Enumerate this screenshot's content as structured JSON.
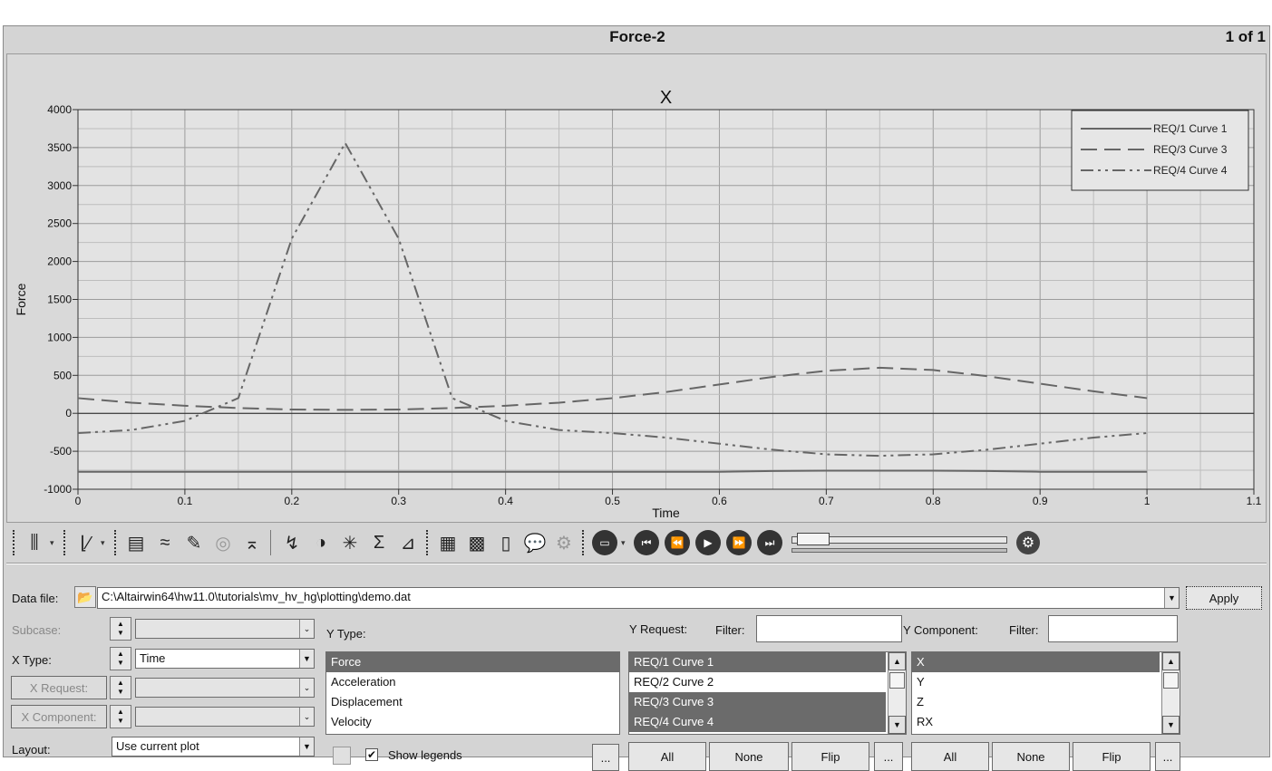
{
  "window": {
    "title": "Force-2",
    "page_count": "1 of 1"
  },
  "chart_data": {
    "type": "line",
    "title": "X",
    "xlabel": "Time",
    "ylabel": "Force",
    "xlim": [
      0,
      1.1
    ],
    "ylim": [
      -1000,
      4000
    ],
    "x_ticks": [
      "0",
      "0.1",
      "0.2",
      "0.3",
      "0.4",
      "0.5",
      "0.6",
      "0.7",
      "0.8",
      "0.9",
      "1",
      "1.1"
    ],
    "y_ticks": [
      "4000",
      "3500",
      "3000",
      "2500",
      "2000",
      "1500",
      "1000",
      "500",
      "0",
      "-500",
      "-1000"
    ],
    "grid": true,
    "legend": "top-right",
    "series": [
      {
        "name": "REQ/1 Curve 1",
        "style": "solid",
        "x": [
          0,
          0.1,
          0.2,
          0.3,
          0.4,
          0.5,
          0.6,
          0.65,
          0.7,
          0.8,
          0.85,
          0.9,
          1.0
        ],
        "y": [
          -770,
          -770,
          -770,
          -770,
          -770,
          -770,
          -770,
          -760,
          -755,
          -755,
          -760,
          -770,
          -770
        ]
      },
      {
        "name": "REQ/3 Curve 3",
        "style": "dash",
        "x": [
          0,
          0.05,
          0.1,
          0.15,
          0.2,
          0.25,
          0.3,
          0.35,
          0.4,
          0.45,
          0.5,
          0.55,
          0.6,
          0.65,
          0.7,
          0.75,
          0.8,
          0.85,
          0.9,
          0.95,
          1.0
        ],
        "y": [
          200,
          140,
          100,
          70,
          50,
          45,
          50,
          70,
          100,
          140,
          200,
          280,
          380,
          480,
          560,
          600,
          570,
          490,
          390,
          290,
          200
        ]
      },
      {
        "name": "REQ/4 Curve 4",
        "style": "dashdotdot",
        "x": [
          0,
          0.05,
          0.1,
          0.15,
          0.2,
          0.25,
          0.3,
          0.35,
          0.4,
          0.45,
          0.5,
          0.55,
          0.6,
          0.65,
          0.7,
          0.75,
          0.8,
          0.85,
          0.9,
          0.95,
          1.0
        ],
        "y": [
          -260,
          -220,
          -100,
          200,
          2300,
          3560,
          2300,
          200,
          -100,
          -220,
          -260,
          -320,
          -400,
          -480,
          -540,
          -560,
          -540,
          -480,
          -400,
          -320,
          -260
        ]
      }
    ]
  },
  "toolbar": {
    "icons": [
      "plot-type-icon",
      "curve-type-icon",
      "curve-attributes-icon",
      "define-curve-icon",
      "edit-curve-icon",
      "stamp-icon",
      "peak-icon",
      "coordinate-info-icon",
      "color-wheel-icon",
      "crosshair-icon",
      "sum-icon",
      "measure-icon",
      "grid-icon",
      "table-grid-icon",
      "notes-icon",
      "comment-icon",
      "settings-cog-icon",
      "animation-mode-icon",
      "first-frame-icon",
      "previous-frame-icon",
      "play-icon",
      "next-frame-icon",
      "last-frame-icon",
      "animation-settings-icon"
    ],
    "animation_progress": 0.02
  },
  "panel": {
    "data_file_label": "Data file:",
    "data_file_path": "C:\\Altairwin64\\hw11.0\\tutorials\\mv_hv_hg\\plotting\\demo.dat",
    "apply_label": "Apply",
    "subcase_label": "Subcase:",
    "subcase_value": "",
    "x_type_label": "X Type:",
    "x_type_value": "Time",
    "x_request_label": "X Request:",
    "x_request_value": "",
    "x_component_label": "X Component:",
    "x_component_value": "",
    "layout_label": "Layout:",
    "layout_value": "Use current plot",
    "y_type_label": "Y Type:",
    "y_types": [
      "Force",
      "Acceleration",
      "Displacement",
      "Velocity"
    ],
    "y_type_selected": [
      0
    ],
    "y_request_label": "Y Request:",
    "y_request_filter_label": "Filter:",
    "y_requests": [
      "REQ/1 Curve 1",
      "REQ/2 Curve 2",
      "REQ/3 Curve 3",
      "REQ/4 Curve 4"
    ],
    "y_request_selected": [
      0,
      2,
      3
    ],
    "y_component_label": "Y Component:",
    "y_component_filter_label": "Filter:",
    "y_components": [
      "X",
      "Y",
      "Z",
      "RX"
    ],
    "y_component_selected": [
      0
    ],
    "show_legends_label": "Show legends",
    "show_legends_checked": true,
    "more_label": "...",
    "all_label": "All",
    "none_label": "None",
    "flip_label": "Flip"
  }
}
